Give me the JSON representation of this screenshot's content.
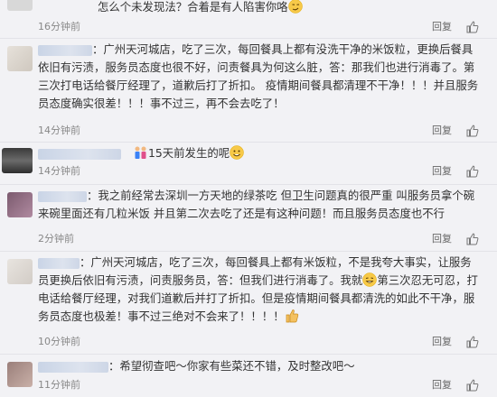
{
  "comments": [
    {
      "text": "怎么个未发现法？合着是有人陷害你咯",
      "time": "16分钟前",
      "reply": "回复"
    },
    {
      "text": "：广州天河城店，吃了三次，每回餐具上都有没洗干净的米饭粒，更换后餐具依旧有污渍，服务员态度也很不好，问责餐具为何这么脏，答：那我们也进行消毒了。第三次打电话给餐厅经理了，道歉后打了折扣。 疫情期间餐具都清理不干净！！！并且服务员态度确实很差！！！事不过三，再不会去吃了！",
      "time": "14分钟前",
      "reply": "回复"
    },
    {
      "text": "15天前发生的呢",
      "time": "14分钟前",
      "reply": "回复"
    },
    {
      "text": "：我之前经常去深圳一方天地的绿茶吃 但卫生问题真的很严重 叫服务员拿个碗来碗里面还有几粒米饭 并且第二次去吃了还是有这种问题！而且服务员态度也不行",
      "time": "2分钟前",
      "reply": "回复"
    },
    {
      "text": "：广州天河城店，吃了三次，每回餐具上都有米饭粒，不是我夸大事实，让服务员更换后依旧有污渍，问责服务员，答：但我们进行消毒了。我就",
      "text2": "第三次忍无可忍，打电话给餐厅经理，对我们道歉后并打了折扣。但是疫情期间餐具都清洗的如此不干净，服务员态度也极差！事不过三绝对不会来了！！！！",
      "time": "10分钟前",
      "reply": "回复"
    },
    {
      "text": "：希望彻查吧～你家有些菜还不错，及时整改吧～",
      "time": "11分钟前",
      "reply": "回复"
    }
  ],
  "colors": {
    "background": "#f2f2f5",
    "text": "#333333",
    "meta": "#888888"
  }
}
